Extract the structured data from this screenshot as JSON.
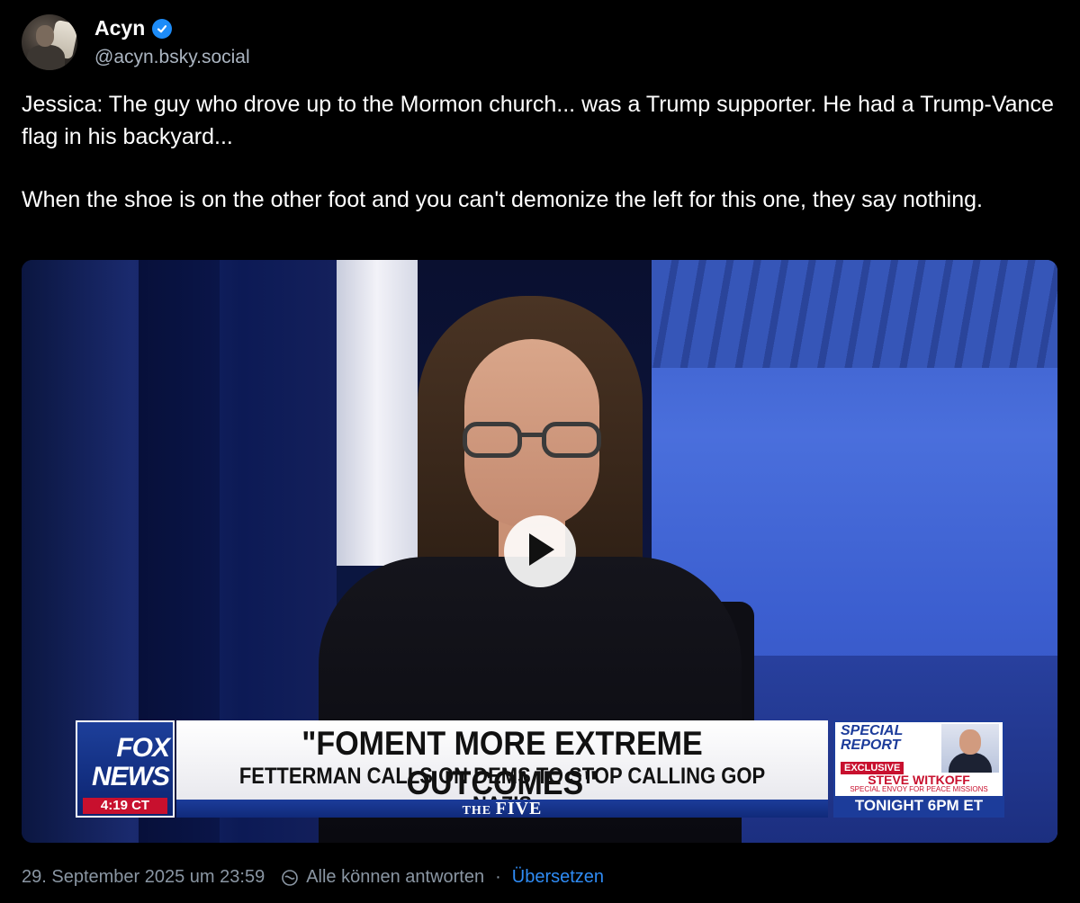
{
  "post": {
    "author": {
      "display_name": "Acyn",
      "handle": "@acyn.bsky.social",
      "verified_icon": "verified-check-icon"
    },
    "text": {
      "paragraph1": "Jessica: The guy who drove up to the Mormon church... was a Trump supporter. He had a Trump-Vance flag in his backyard...",
      "paragraph2": "When the shoe is on the other foot and you can't demonize the left for this one, they say nothing."
    },
    "video": {
      "play_icon": "play-icon",
      "chyron": {
        "network_line1": "FOX",
        "network_line2": "NEWS",
        "time": "4:19 CT",
        "headline": "\"FOMENT MORE EXTREME OUTCOMES\"",
        "subheadline": "FETTERMAN CALLS ON DEMS TO STOP CALLING GOP NAZIS",
        "show_prefix": "THE",
        "show_name": "FIVE",
        "promo_label": "SPECIAL REPORT",
        "promo_tag": "EXCLUSIVE",
        "promo_guest": "STEVE WITKOFF",
        "promo_guest_role": "SPECIAL ENVOY FOR PEACE MISSIONS",
        "promo_time": "TONIGHT 6PM ET"
      }
    },
    "footer": {
      "timestamp": "29. September 2025 um 23:59",
      "reply_setting": "Alle können antworten",
      "separator": "·",
      "translate_link": "Übersetzen"
    }
  },
  "colors": {
    "background": "#000000",
    "text": "#ffffff",
    "muted": "#8a96a3",
    "link": "#2f8cf5",
    "verified": "#1d8cf8"
  }
}
